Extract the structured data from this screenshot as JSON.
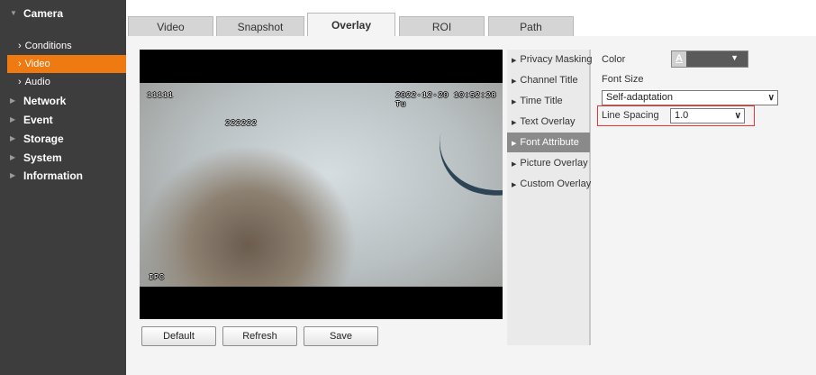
{
  "sidebar": {
    "camera": "Camera",
    "sub_items": [
      "Conditions",
      "Video",
      "Audio"
    ],
    "active_sub": "Video",
    "items": [
      "Network",
      "Event",
      "Storage",
      "System",
      "Information"
    ]
  },
  "tabs": [
    "Video",
    "Snapshot",
    "Overlay",
    "ROI",
    "Path"
  ],
  "active_tab": "Overlay",
  "video": {
    "osd_top_left": "11111",
    "osd_timestamp": "2022-12-20 10:52:28 Tu",
    "osd_text": "222222",
    "osd_channel": "IPC"
  },
  "buttons": {
    "default": "Default",
    "refresh": "Refresh",
    "save": "Save"
  },
  "overlay_menu": {
    "items": [
      "Privacy Masking",
      "Channel Title",
      "Time Title",
      "Text Overlay",
      "Font Attribute",
      "Picture Overlay",
      "Custom Overlay"
    ],
    "active": "Font Attribute"
  },
  "settings": {
    "color_label": "Color",
    "color_swatch_text": "A",
    "font_size_label": "Font Size",
    "font_size_value": "Self-adaptation",
    "line_spacing_label": "Line Spacing",
    "line_spacing_value": "1.0"
  },
  "colors": {
    "sidebar_bg": "#3d3d3d",
    "active_orange": "#f07a12",
    "highlight_red": "#e33333"
  }
}
